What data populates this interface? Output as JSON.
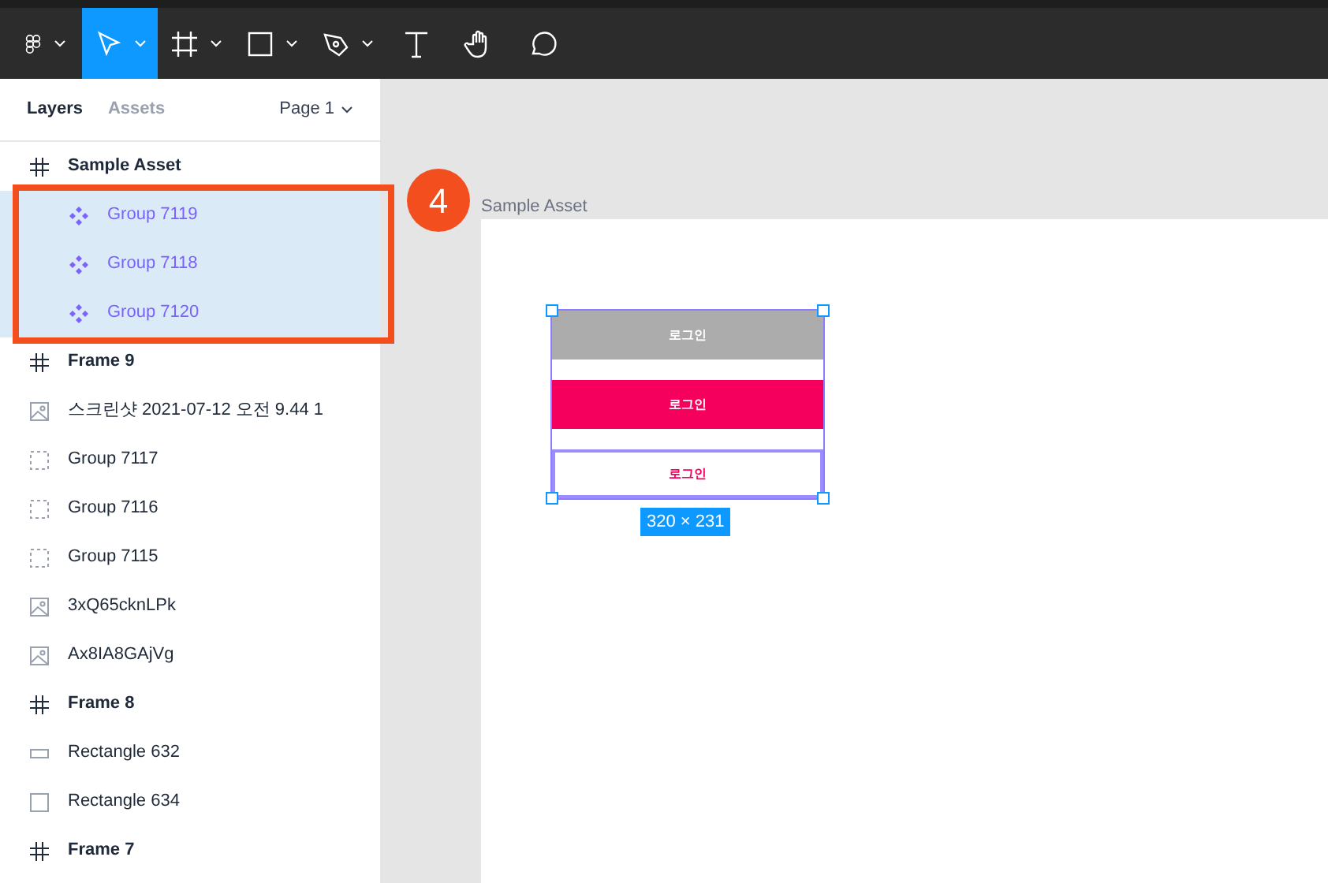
{
  "toolbar": {
    "tools": [
      {
        "kind": "logo",
        "selected": false,
        "menu": true
      },
      {
        "kind": "move",
        "selected": true,
        "menu": true
      },
      {
        "kind": "frame",
        "selected": false,
        "menu": true
      },
      {
        "kind": "shape",
        "selected": false,
        "menu": true
      },
      {
        "kind": "pen",
        "selected": false,
        "menu": true
      },
      {
        "kind": "text",
        "selected": false,
        "menu": false
      },
      {
        "kind": "hand",
        "selected": false,
        "menu": false
      },
      {
        "kind": "comment",
        "selected": false,
        "menu": false
      }
    ]
  },
  "sidebar": {
    "tabs": [
      {
        "label": "Layers",
        "selected": true
      },
      {
        "label": "Assets",
        "selected": false
      }
    ],
    "page": "Page 1",
    "layers": [
      {
        "kind": "frame",
        "name": "Sample Asset",
        "selected": false,
        "children": [
          {
            "kind": "component",
            "name": "Group 7119",
            "selected": true
          },
          {
            "kind": "component",
            "name": "Group 7118",
            "selected": true
          },
          {
            "kind": "component",
            "name": "Group 7120",
            "selected": true
          }
        ]
      },
      {
        "kind": "frame",
        "name": "Frame 9",
        "selected": false
      },
      {
        "kind": "image",
        "name": "스크린샷 2021-07-12 오전 9.44 1",
        "selected": false
      },
      {
        "kind": "group",
        "name": "Group 7117",
        "selected": false
      },
      {
        "kind": "group",
        "name": "Group 7116",
        "selected": false
      },
      {
        "kind": "group",
        "name": "Group 7115",
        "selected": false
      },
      {
        "kind": "image",
        "name": "3xQ65cknLPk",
        "selected": false
      },
      {
        "kind": "image",
        "name": "Ax8IA8GAjVg",
        "selected": false
      },
      {
        "kind": "frame",
        "name": "Frame 8",
        "selected": false
      },
      {
        "kind": "rect-wide",
        "name": "Rectangle 632",
        "selected": false
      },
      {
        "kind": "rect",
        "name": "Rectangle 634",
        "selected": false
      },
      {
        "kind": "frame",
        "name": "Frame 7",
        "selected": false
      }
    ]
  },
  "callout": {
    "number": "4"
  },
  "canvas": {
    "frame_label": "Sample Asset",
    "size_label": "320 × 231",
    "buttons": [
      {
        "kind": "disabled",
        "label": "로그인"
      },
      {
        "kind": "filled",
        "label": "로그인"
      },
      {
        "kind": "outline",
        "label": "로그인"
      }
    ]
  }
}
